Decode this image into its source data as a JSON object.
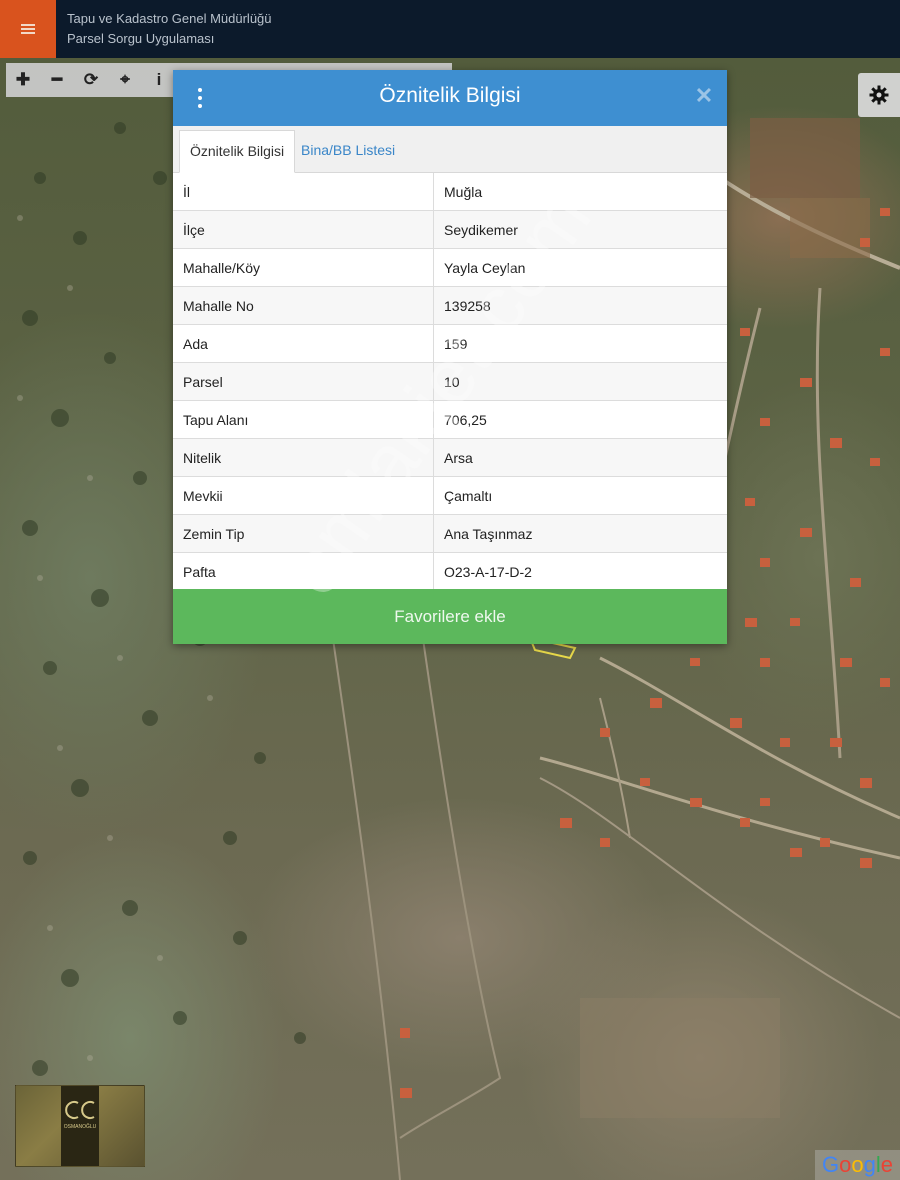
{
  "header": {
    "title": "Tapu ve Kadastro Genel Müdürlüğü",
    "subtitle": "Parsel Sorgu Uygulaması",
    "menu_icon": "hamburger-menu-icon",
    "menu_color": "#d9531e",
    "background_color": "#0c1a2b"
  },
  "toolbar": {
    "tools": [
      {
        "icon": "zoom-in-icon",
        "glyph": "✚"
      },
      {
        "icon": "zoom-out-icon",
        "glyph": "━"
      },
      {
        "icon": "refresh-icon",
        "glyph": "⟳"
      },
      {
        "icon": "locate-icon",
        "glyph": "⌖"
      },
      {
        "icon": "info-icon",
        "glyph": "i"
      }
    ],
    "settings_icon": "gear-icon"
  },
  "dialog": {
    "title": "Öznitelik Bilgisi",
    "header_color": "#3e8fd1",
    "tabs": [
      {
        "label": "Öznitelik Bilgisi",
        "active": true
      },
      {
        "label": "Bina/BB Listesi",
        "active": false
      }
    ],
    "attributes": [
      {
        "key": "İl",
        "value": "Muğla"
      },
      {
        "key": "İlçe",
        "value": "Seydikemer"
      },
      {
        "key": "Mahalle/Köy",
        "value": "Yayla Ceylan"
      },
      {
        "key": "Mahalle No",
        "value": "139258"
      },
      {
        "key": "Ada",
        "value": "159"
      },
      {
        "key": "Parsel",
        "value": "10"
      },
      {
        "key": "Tapu Alanı",
        "value": "706,25"
      },
      {
        "key": "Nitelik",
        "value": "Arsa"
      },
      {
        "key": "Mevkii",
        "value": "Çamaltı"
      },
      {
        "key": "Zemin Tip",
        "value": "Ana Taşınmaz"
      },
      {
        "key": "Pafta",
        "value": "O23-A-17-D-2"
      }
    ],
    "favorite_button": "Favorilere ekle",
    "favorite_color": "#5cb85c"
  },
  "watermark": "emlakjet.com",
  "logo": {
    "text": "OSMANOĞLU"
  },
  "google": [
    "G",
    "o",
    "o",
    "g",
    "l",
    "e"
  ]
}
